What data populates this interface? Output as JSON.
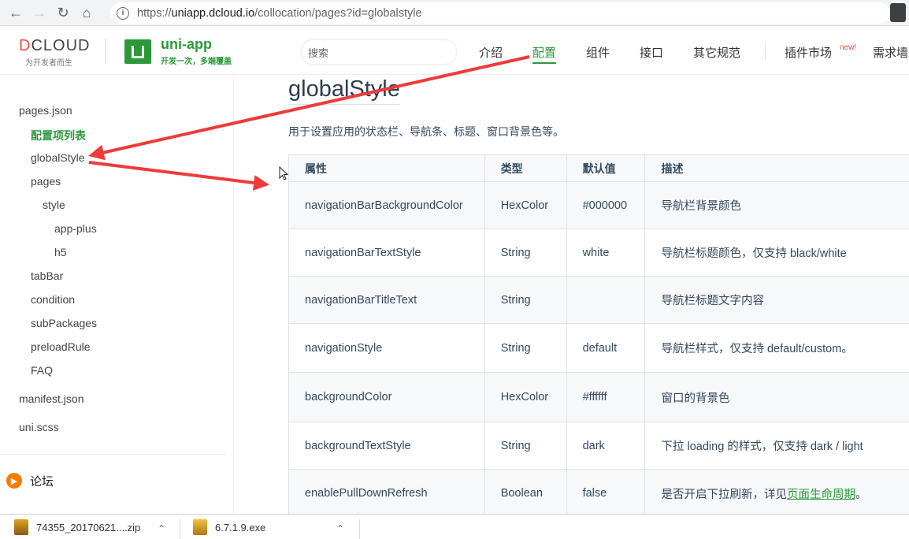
{
  "browser": {
    "url_prefix": "https://",
    "url_host": "uniapp.dcloud.io",
    "url_path": "/collocation/pages?id=globalstyle"
  },
  "header": {
    "dcloud_name_part1": "D",
    "dcloud_name_part2": "CLOUD",
    "dcloud_slogan": "为开发者而生",
    "uni_name": "uni-app",
    "uni_slogan": "开发一次，多端覆盖",
    "search_placeholder": "搜索",
    "nav": [
      "介绍",
      "配置",
      "组件",
      "接口",
      "其它规范",
      "插件市场",
      "需求墙"
    ],
    "new_badge": "new!"
  },
  "sidebar": {
    "items": [
      "pages.json",
      "配置项列表",
      "globalStyle",
      "pages",
      "style",
      "app-plus",
      "h5",
      "tabBar",
      "condition",
      "subPackages",
      "preloadRule",
      "FAQ",
      "manifest.json",
      "uni.scss"
    ],
    "forum_label": "论坛"
  },
  "main": {
    "title": "globalStyle",
    "description": "用于设置应用的状态栏、导航条、标题、窗口背景色等。",
    "table": {
      "headers": [
        "属性",
        "类型",
        "默认值",
        "描述"
      ],
      "rows": [
        [
          "navigationBarBackgroundColor",
          "HexColor",
          "#000000",
          "导航栏背景颜色"
        ],
        [
          "navigationBarTextStyle",
          "String",
          "white",
          "导航栏标题颜色，仅支持 black/white"
        ],
        [
          "navigationBarTitleText",
          "String",
          "",
          "导航栏标题文字内容"
        ],
        [
          "navigationStyle",
          "String",
          "default",
          "导航栏样式，仅支持 default/custom。"
        ],
        [
          "backgroundColor",
          "HexColor",
          "#ffffff",
          "窗口的背景色"
        ],
        [
          "backgroundTextStyle",
          "String",
          "dark",
          "下拉 loading 的样式，仅支持 dark / light"
        ],
        [
          "enablePullDownRefresh",
          "Boolean",
          "false",
          "是否开启下拉刷新，详见"
        ]
      ],
      "last_row_link": "页面生命周期",
      "last_row_suffix": "。"
    }
  },
  "downloads": [
    {
      "name": "74355_20170621....zip"
    },
    {
      "name": "6.7.1.9.exe"
    }
  ],
  "colors": {
    "accent": "#2b9939",
    "annotation": "#f03a3a"
  }
}
